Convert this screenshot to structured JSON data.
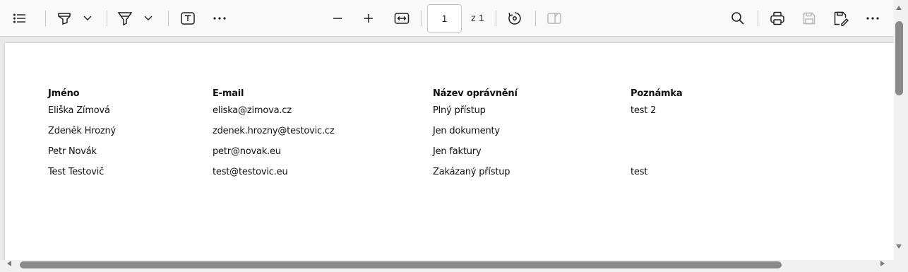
{
  "toolbar": {
    "page_current": "1",
    "page_total": "z 1",
    "icons": [
      "contents-list-icon",
      "highlight-icon",
      "chevron-down-icon",
      "draw-icon",
      "chevron-down-icon",
      "text-box-icon",
      "more-icon",
      "zoom-out-icon",
      "zoom-in-icon",
      "fit-width-icon",
      "rotate-icon",
      "page-view-icon",
      "search-icon",
      "print-icon",
      "save-icon",
      "save-as-icon",
      "more-icon"
    ]
  },
  "table": {
    "headers": [
      "Jméno",
      "E-mail",
      "Název oprávnění",
      "Poznámka"
    ],
    "rows": [
      [
        "Eliška Zímová",
        "eliska@zimova.cz",
        "Plný přístup",
        "test 2"
      ],
      [
        "Zdeněk Hrozný",
        "zdenek.hrozny@testovic.cz",
        "Jen dokumenty",
        ""
      ],
      [
        "Petr Novák",
        "petr@novak.eu",
        "Jen faktury",
        ""
      ],
      [
        "Test Testovič",
        "test@testovic.eu",
        "Zakázaný přístup",
        "test"
      ]
    ]
  }
}
